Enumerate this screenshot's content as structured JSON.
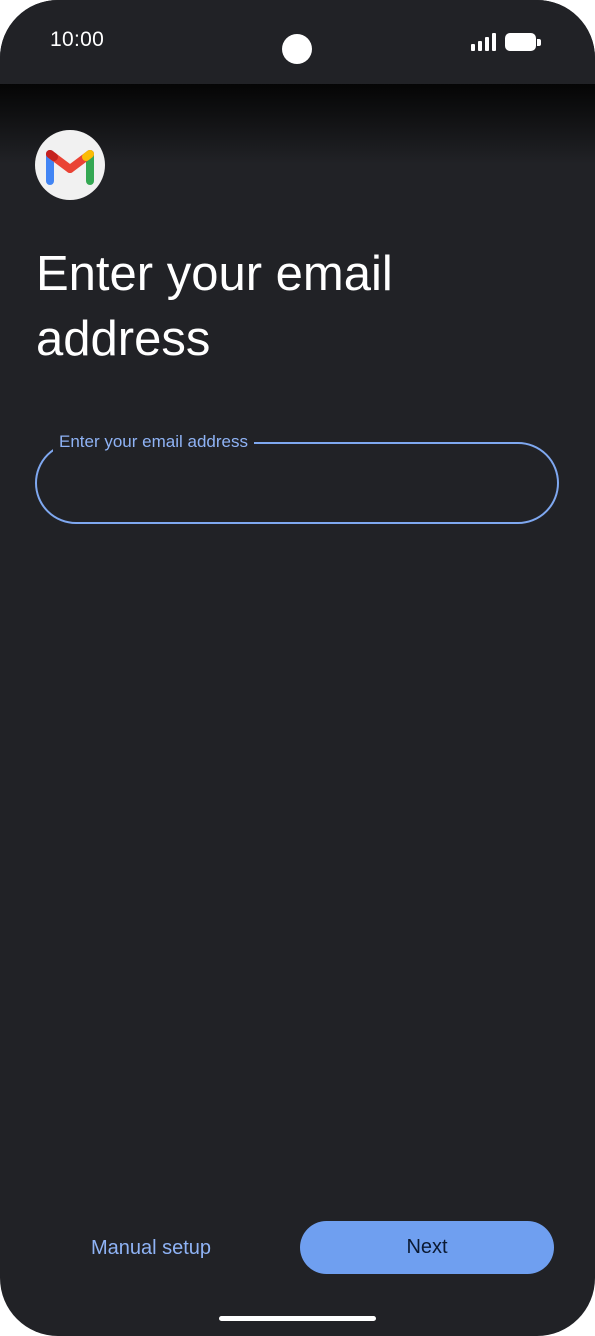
{
  "status_bar": {
    "time": "10:00",
    "signal_icon": "cellular-signal-icon",
    "battery_icon": "battery-icon"
  },
  "app": {
    "logo_icon": "gmail-logo-icon"
  },
  "main": {
    "title": "Enter your email address",
    "email_field": {
      "label": "Enter your email address",
      "value": "",
      "accent_color": "#7fa8f0"
    }
  },
  "footer": {
    "manual_setup_label": "Manual setup",
    "next_label": "Next",
    "next_color": "#6f9ff0"
  },
  "colors": {
    "background": "#212226",
    "text": "#ffffff",
    "accent": "#8fb3f5"
  }
}
